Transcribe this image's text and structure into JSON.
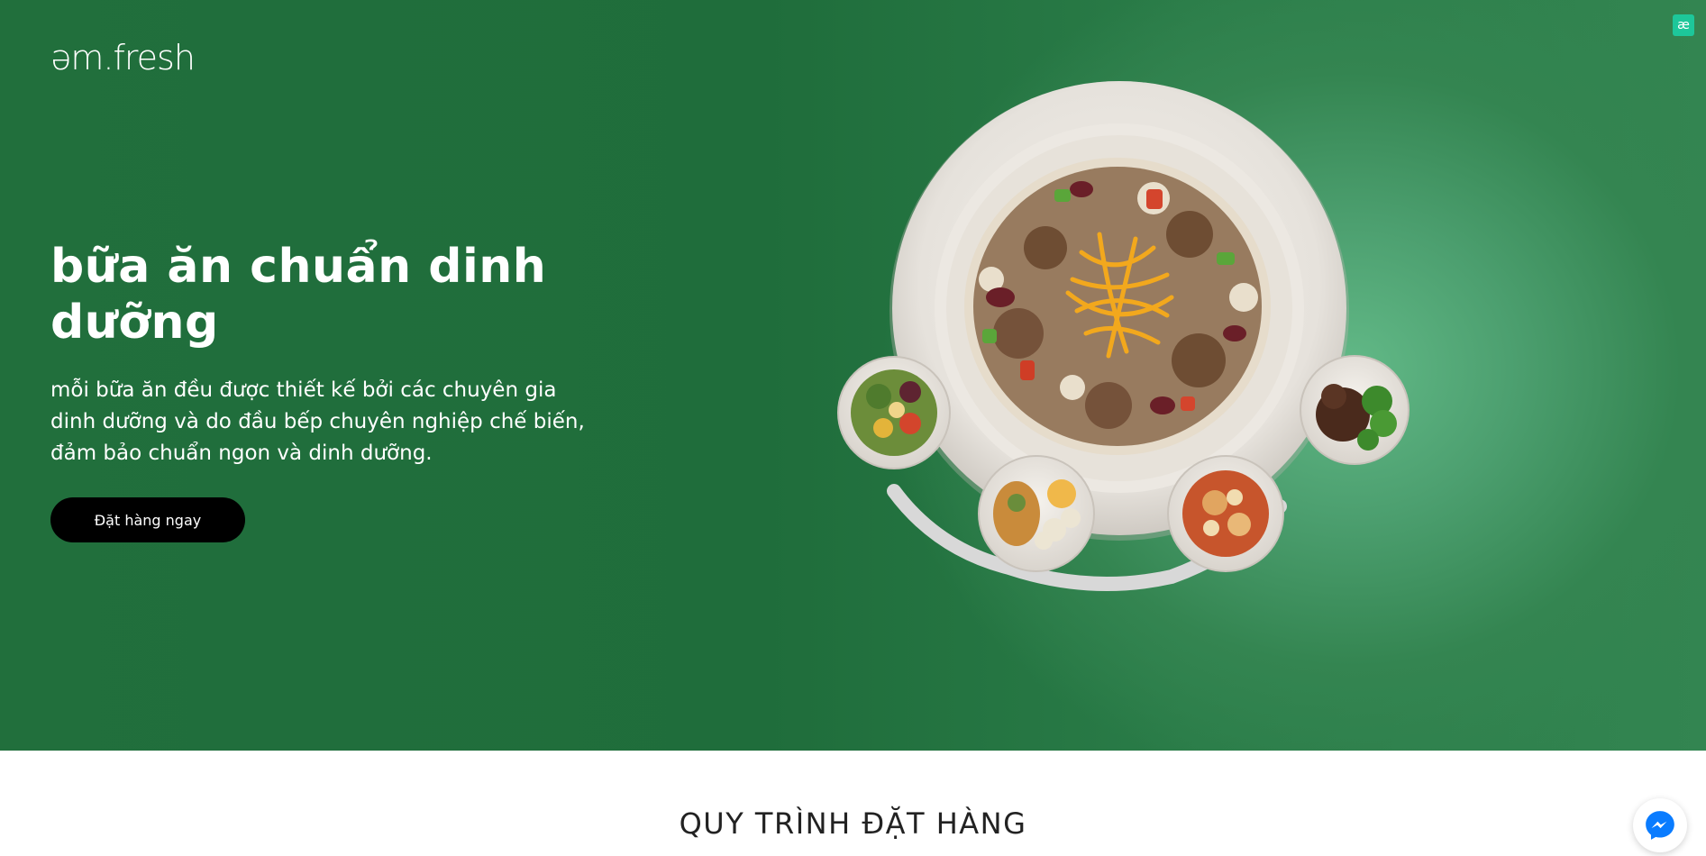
{
  "brand": {
    "logo_text": "əm.fresh",
    "badge_text": "æ"
  },
  "hero": {
    "title": "bữa ăn chuẩn dinh dưỡng",
    "description": "mỗi bữa ăn đều được thiết kế bởi các chuyên gia dinh dưỡng và do đầu bếp chuyên nghiệp chế biến, đảm bảo chuẩn ngon và dinh dưỡng.",
    "cta_label": "Đặt hàng ngay"
  },
  "process_section": {
    "title": "QUY TRÌNH ĐẶT HÀNG"
  },
  "colors": {
    "hero_green": "#1f6d3b",
    "hero_glow": "#62b987",
    "cta_background": "#000000",
    "badge": "#1dc79a",
    "messenger_blue": "#0a7cff"
  },
  "icons": {
    "chat": "messenger-icon",
    "badge": "ae-icon"
  }
}
